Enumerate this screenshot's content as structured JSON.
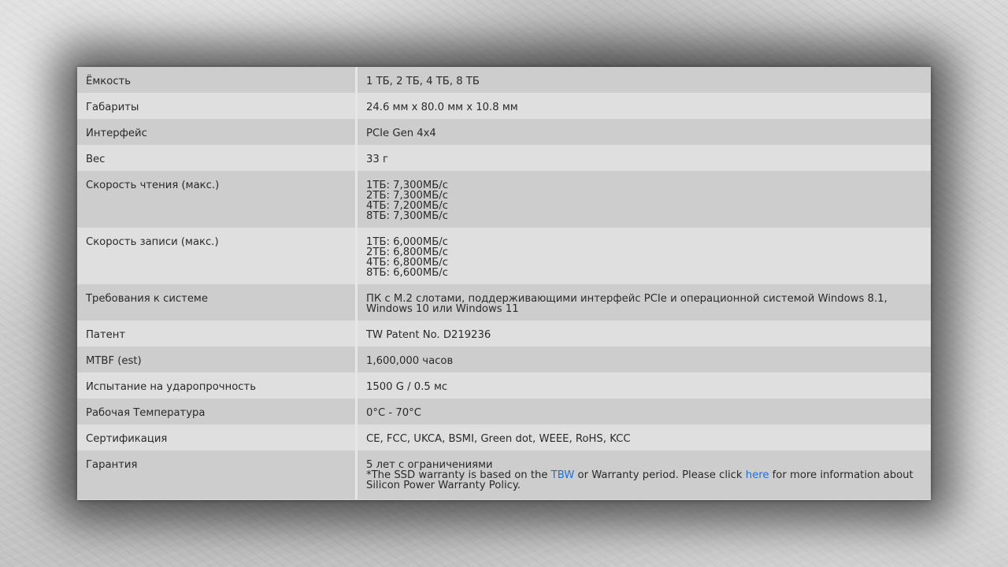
{
  "specs": [
    {
      "label": "Ёмкость",
      "value": "1 ТБ, 2 ТБ, 4 ТБ, 8 ТБ"
    },
    {
      "label": "Габариты",
      "value": "24.6 мм x 80.0 мм x 10.8 мм"
    },
    {
      "label": "Интерфейс",
      "value": "PCIe Gen 4x4"
    },
    {
      "label": "Вес",
      "value": "33 г"
    },
    {
      "label": "Скорость чтения (макс.)",
      "lines": [
        "1ТБ: 7,300МБ/с",
        "2ТБ: 7,300МБ/с",
        "4ТБ: 7,200МБ/с",
        "8ТБ: 7,300МБ/с"
      ]
    },
    {
      "label": "Скорость записи (макс.)",
      "lines": [
        "1ТБ: 6,000МБ/с",
        "2ТБ: 6,800МБ/с",
        "4ТБ: 6,800МБ/с",
        "8ТБ: 6,600МБ/с"
      ]
    },
    {
      "label": "Требования к системе",
      "value": "ПК с M.2 слотами, поддерживающими интерфейс PCIe и операционной системой Windows 8.1, Windows 10 или Windows 11"
    },
    {
      "label": "Патент",
      "value": "TW Patent No. D219236"
    },
    {
      "label": "MTBF (est)",
      "value": "1,600,000 часов"
    },
    {
      "label": "Испытание на ударопрочность",
      "value": "1500 G / 0.5 мс"
    },
    {
      "label": "Рабочая Температура",
      "value": "0°C - 70°C"
    },
    {
      "label": "Сертификация",
      "value": "CE, FCC, UKCA, BSMI, Green dot, WEEE, RoHS, KCC"
    },
    {
      "label": "Гарантия",
      "warranty": {
        "line1": "5 лет с ограничениями",
        "note_pre": "*The SSD warranty is based on the ",
        "tbw_link": "TBW",
        "note_mid": " or Warranty period. Please click ",
        "here_link": "here",
        "note_post": " for more information about Silicon Power Warranty Policy."
      }
    }
  ]
}
